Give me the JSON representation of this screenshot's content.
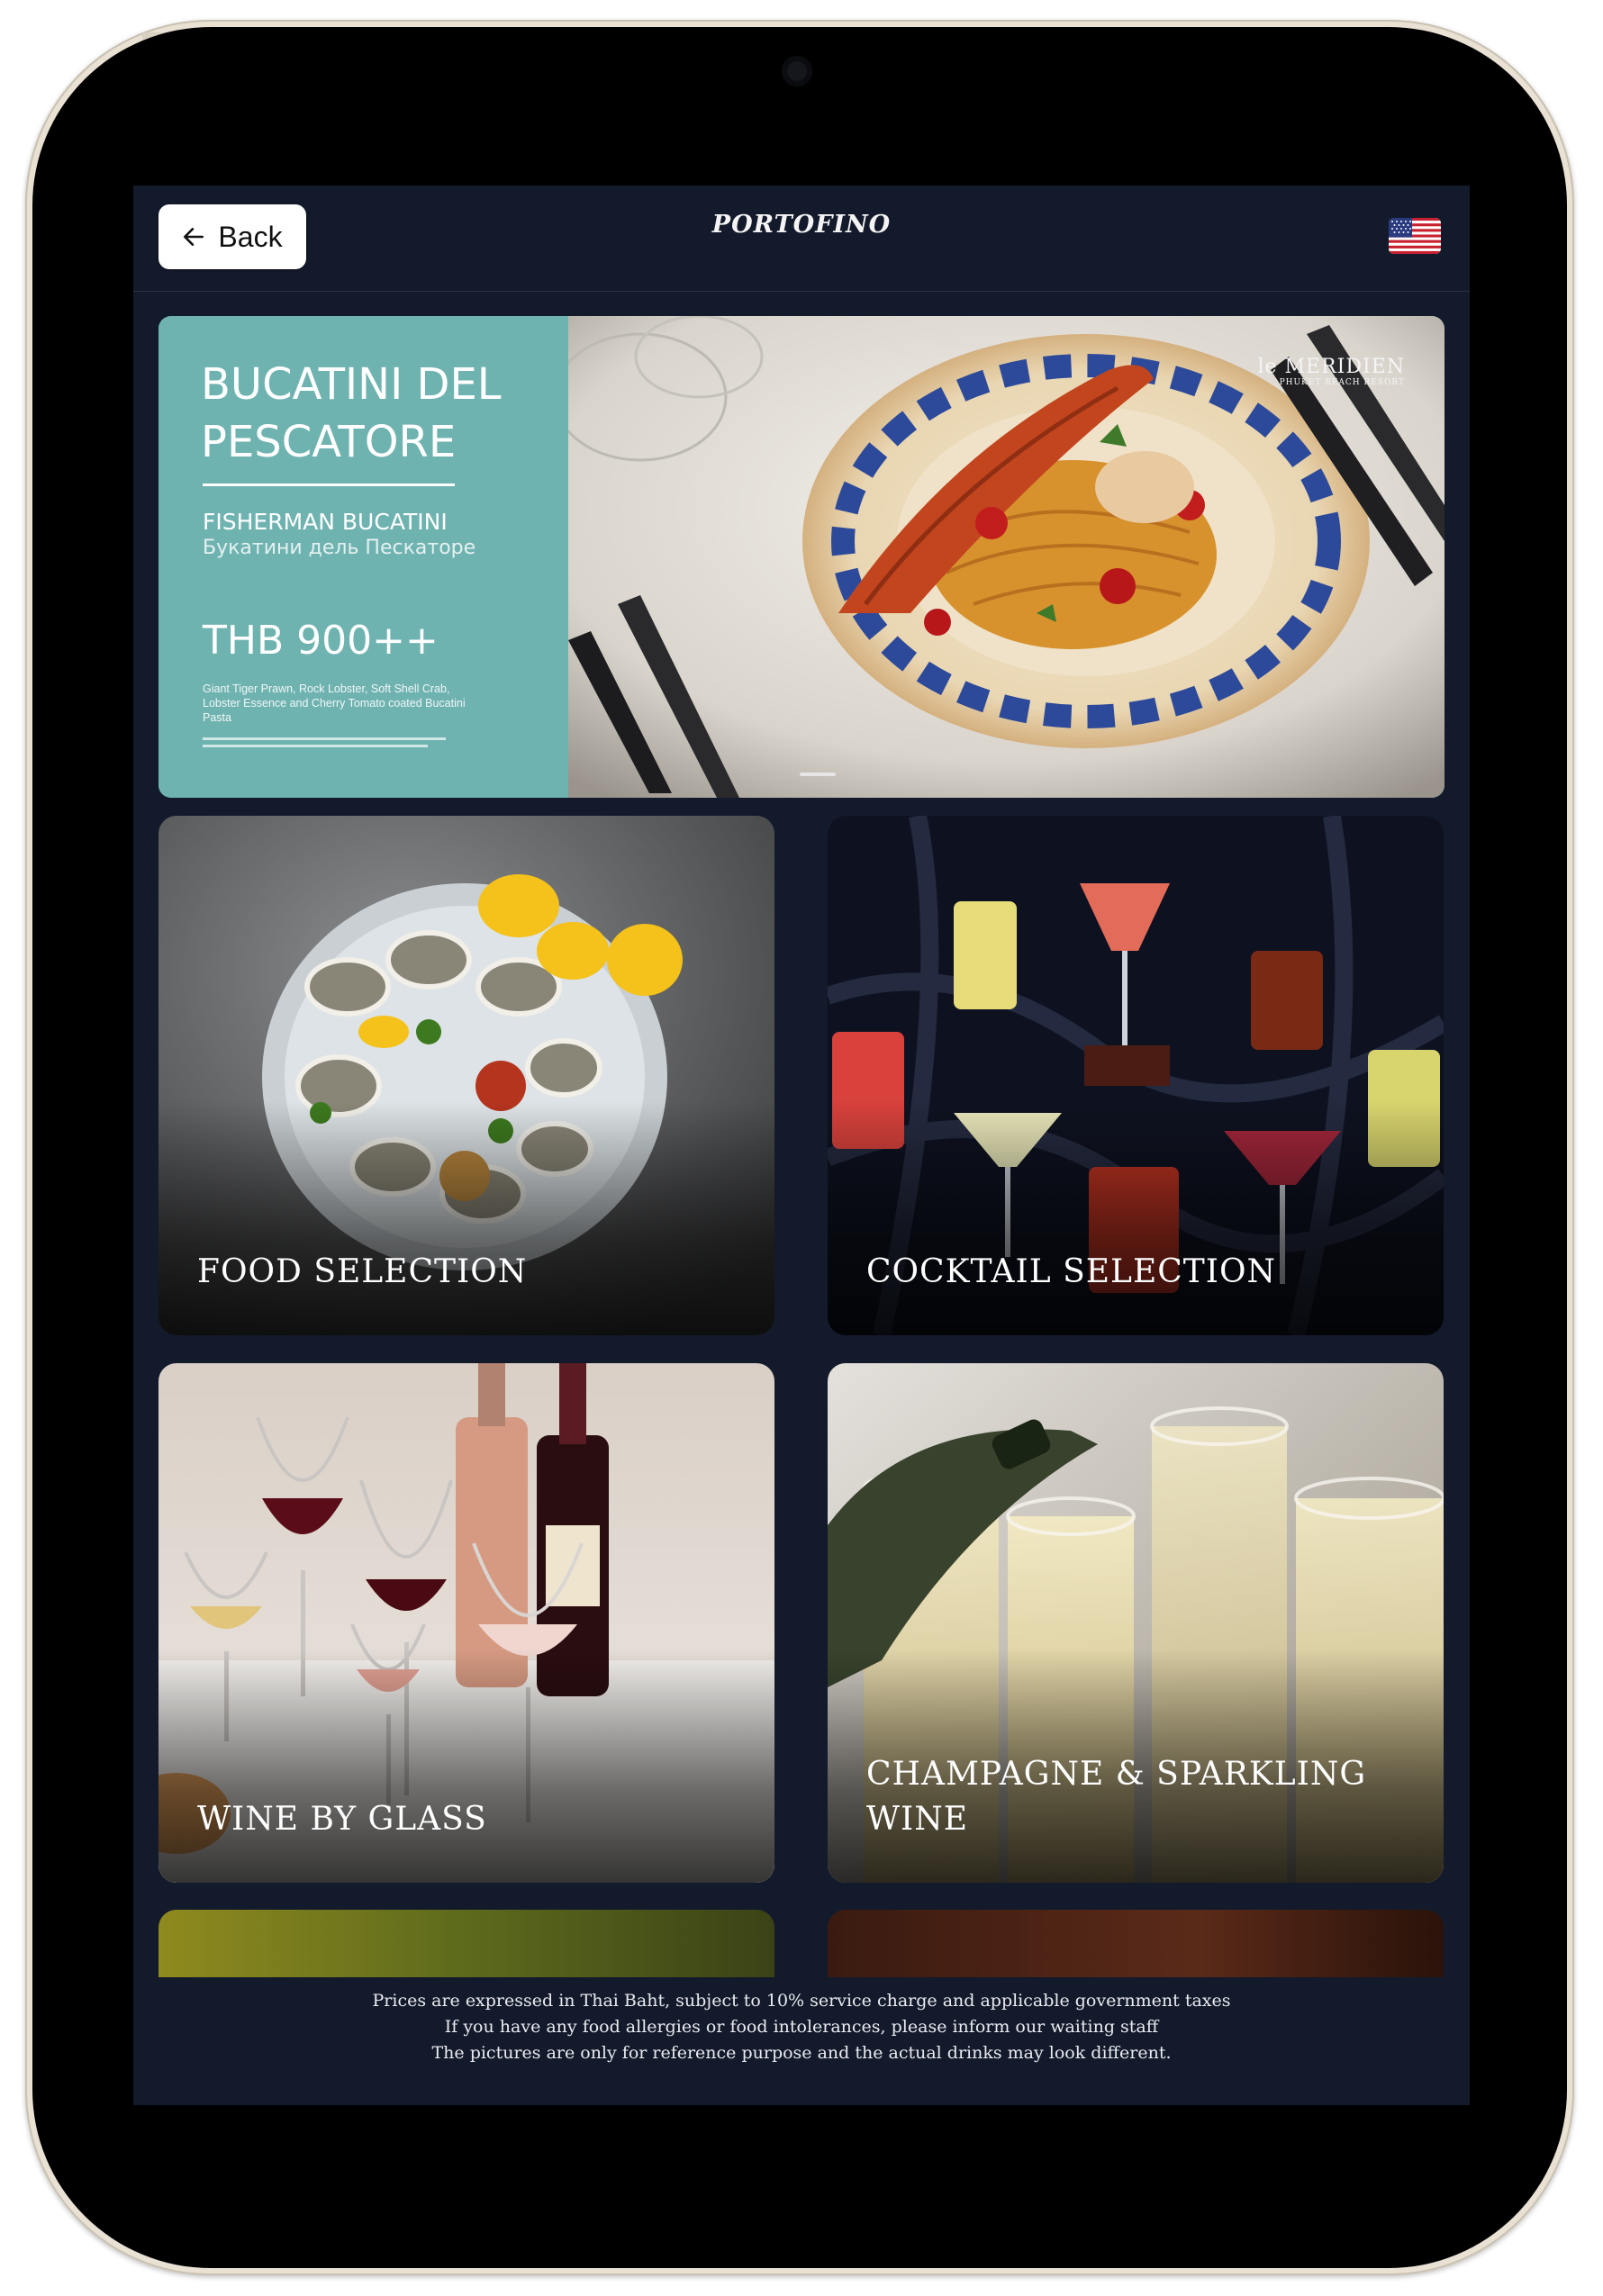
{
  "header": {
    "back_label": "Back",
    "logo": "PORTOFINO",
    "language_flag": "us-flag-icon"
  },
  "hero": {
    "title": "BUCATINI DEL PESCATORE",
    "subtitle_en": "FISHERMAN BUCATINI",
    "subtitle_ru": "Букатини дель Пескаторе",
    "price": "THB 900++",
    "description": "Giant Tiger Prawn, Rock Lobster, Soft Shell Crab, Lobster Essence and Cherry Tomato coated Bucatini Pasta",
    "brand_line1": "le MERIDIEN",
    "brand_line2": "PHUKET BEACH RESORT",
    "colors": {
      "panel": "#6fb3b1"
    }
  },
  "categories": [
    {
      "label": "FOOD SELECTION"
    },
    {
      "label": "COCKTAIL SELECTION"
    },
    {
      "label": "WINE BY GLASS"
    },
    {
      "label": "CHAMPAGNE & SPARKLING WINE"
    }
  ],
  "footer": {
    "line1": "Prices are expressed in Thai Baht, subject to 10% service charge and applicable government taxes",
    "line2": "If you have any food allergies or food intolerances, please inform our waiting staff",
    "line3": "The pictures are only for reference purpose and the actual drinks may look different."
  },
  "colors": {
    "app_background": "#131a2b",
    "hero_panel": "#6fb3b1",
    "device_frame": "#e9e2d4"
  }
}
